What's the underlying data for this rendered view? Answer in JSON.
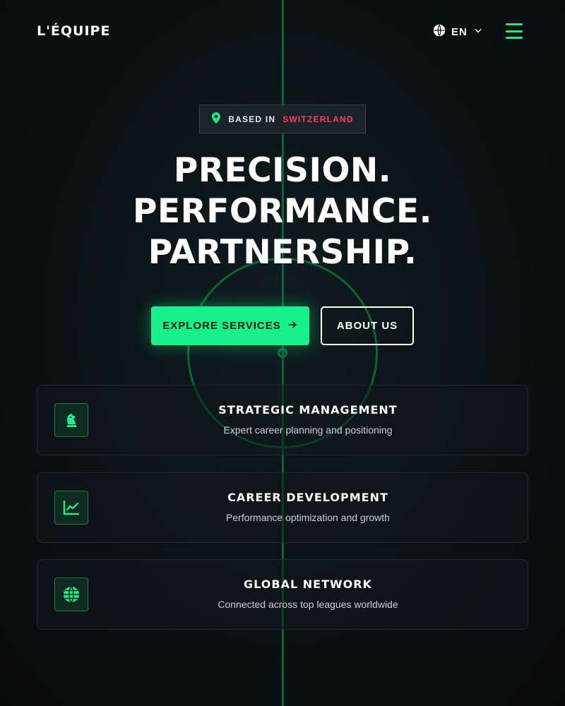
{
  "header": {
    "logo": "L'ÉQUIPE",
    "language": "EN",
    "language_icon": "globe-icon",
    "menu_icon": "hamburger-menu-icon"
  },
  "badge": {
    "prefix": "BASED IN",
    "location": "SWITZERLAND",
    "icon": "map-pin-icon"
  },
  "hero": {
    "lines": [
      "PRECISION.",
      "PERFORMANCE.",
      "PARTNERSHIP."
    ]
  },
  "buttons": {
    "primary": "EXPLORE SERVICES",
    "secondary": "ABOUT US"
  },
  "services": [
    {
      "icon": "chess-knight-icon",
      "title": "STRATEGIC MANAGEMENT",
      "description": "Expert career planning and positioning"
    },
    {
      "icon": "chart-line-icon",
      "title": "CAREER DEVELOPMENT",
      "description": "Performance optimization and growth"
    },
    {
      "icon": "globe-icon",
      "title": "GLOBAL NETWORK",
      "description": "Connected across top leagues worldwide"
    }
  ],
  "colors": {
    "accent": "#18f08b",
    "highlight": "#ff3b6e",
    "background": "#0b1113"
  }
}
